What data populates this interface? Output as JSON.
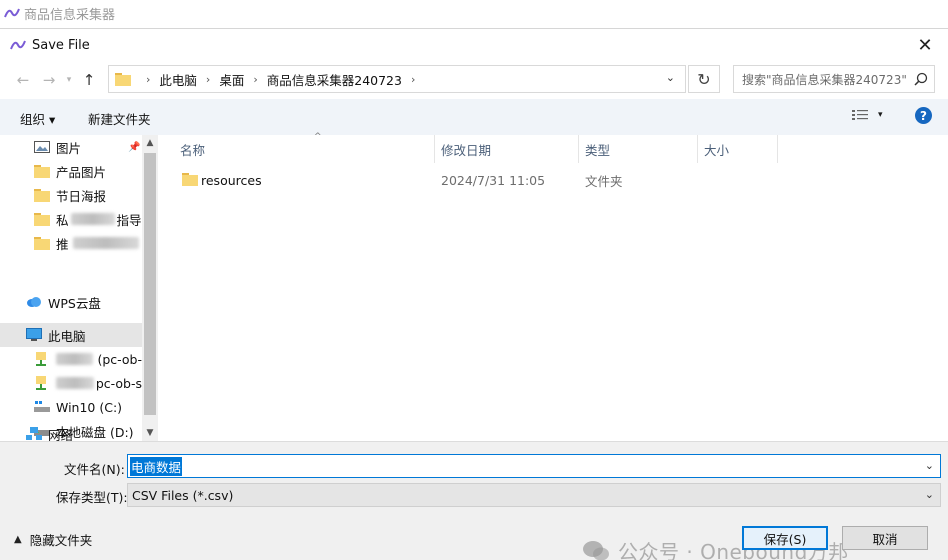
{
  "app": {
    "title": "商品信息采集器"
  },
  "dialog": {
    "title": "Save File",
    "close_glyph": "✕"
  },
  "address_bar": {
    "crumbs": [
      "此电脑",
      "桌面",
      "商品信息采集器240723"
    ],
    "search_placeholder": "搜索\"商品信息采集器240723\""
  },
  "toolbar": {
    "organize_label": "组织 ▾",
    "new_folder_label": "新建文件夹",
    "help_label": "?"
  },
  "nav_pane": {
    "items": [
      {
        "label": "图片",
        "icon": "pictures-icon"
      },
      {
        "label": "产品图片",
        "icon": "folder-icon"
      },
      {
        "label": "节日海报",
        "icon": "folder-icon"
      },
      {
        "label": "私",
        "suffix": "指导",
        "icon": "folder-icon",
        "blurred": true
      },
      {
        "label": "推",
        "icon": "folder-icon",
        "blurred": true
      },
      {
        "label": "WPS云盘",
        "icon": "cloud-icon"
      },
      {
        "label": "此电脑",
        "icon": "computer-icon",
        "selected": true
      },
      {
        "label": "(pc-ob-",
        "icon": "network-drive-icon",
        "blurred": true
      },
      {
        "label": "pc-ob-s",
        "icon": "network-drive-icon",
        "blurred": true
      },
      {
        "label": "Win10 (C:)",
        "icon": "windows-drive-icon"
      },
      {
        "label": "本地磁盘 (D:)",
        "icon": "drive-icon"
      },
      {
        "label": "网络",
        "icon": "network-icon"
      }
    ]
  },
  "file_list": {
    "columns": [
      "名称",
      "修改日期",
      "类型",
      "大小"
    ],
    "rows": [
      {
        "name": "resources",
        "modified": "2024/7/31 11:05",
        "type": "文件夹",
        "size": ""
      }
    ]
  },
  "form": {
    "filename_label": "文件名(N):",
    "filename_value": "电商数据",
    "filetype_label": "保存类型(T):",
    "filetype_value": "CSV Files (*.csv)",
    "hide_folders_label": "隐藏文件夹",
    "save_label": "保存(S)",
    "cancel_label": "取消"
  },
  "watermark": {
    "text": "公众号 · Onebound万邦"
  },
  "colors": {
    "accent": "#0078d7",
    "toolbar_bg": "#f0f4f9",
    "form_bg": "#f0f0f0",
    "folder": "#f8d775"
  }
}
